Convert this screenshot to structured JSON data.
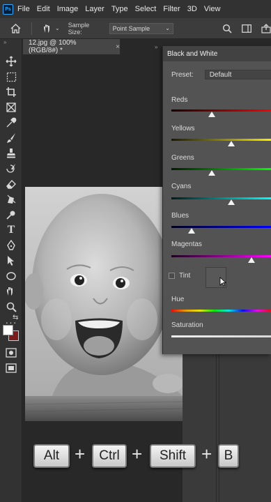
{
  "app": {
    "logo": "Ps"
  },
  "menu": [
    "File",
    "Edit",
    "Image",
    "Layer",
    "Type",
    "Select",
    "Filter",
    "3D",
    "View"
  ],
  "options_bar": {
    "sample_size_label": "Sample Size:",
    "sample_size_value": "Point Sample"
  },
  "document": {
    "tab_title": "12.jpg @ 100% (RGB/8#) *",
    "close_glyph": "×"
  },
  "dialog": {
    "title": "Black and White",
    "preset_label": "Preset:",
    "preset_value": "Default",
    "sliders": [
      {
        "label": "Reds",
        "value": 40,
        "gradient": [
          "#1a0000",
          "#ff0000"
        ]
      },
      {
        "label": "Yellows",
        "value": 60,
        "gradient": [
          "#1a1a00",
          "#ffee00"
        ]
      },
      {
        "label": "Greens",
        "value": 40,
        "gradient": [
          "#001a00",
          "#00ff00"
        ]
      },
      {
        "label": "Cyans",
        "value": 60,
        "gradient": [
          "#001a1a",
          "#00ffff"
        ]
      },
      {
        "label": "Blues",
        "value": 20,
        "gradient": [
          "#00001a",
          "#0000ff"
        ]
      },
      {
        "label": "Magentas",
        "value": 80,
        "gradient": [
          "#1a001a",
          "#ff00ff"
        ]
      }
    ],
    "tint_label": "Tint",
    "hue_label": "Hue",
    "saturation_label": "Saturation"
  },
  "shortcut": {
    "keys": [
      "Alt",
      "Ctrl",
      "Shift",
      "B"
    ],
    "separator": "+"
  }
}
